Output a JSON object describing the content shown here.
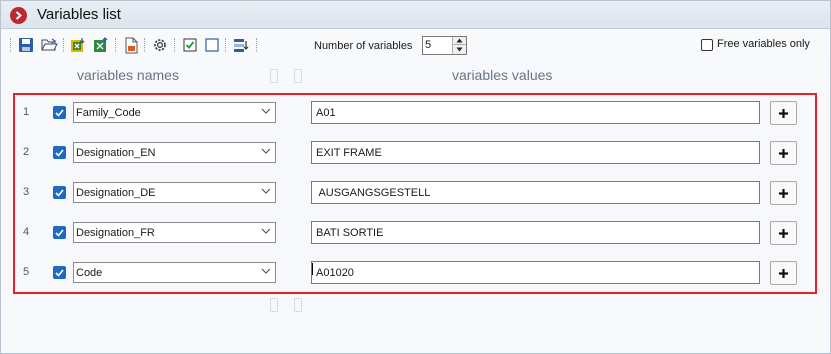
{
  "window": {
    "title": "Variables list"
  },
  "toolbar": {
    "number_label": "Number of variables",
    "number_value": "5",
    "free_only_label": "Free variables only",
    "free_only_checked": false
  },
  "columns": {
    "names": "variables names",
    "values": "variables values"
  },
  "rows": [
    {
      "index": "1",
      "checked": true,
      "name": "Family_Code",
      "value": "A01"
    },
    {
      "index": "2",
      "checked": true,
      "name": "Designation_EN",
      "value": "EXIT FRAME"
    },
    {
      "index": "3",
      "checked": true,
      "name": "Designation_DE",
      "value": " AUSGANGSGESTELL"
    },
    {
      "index": "4",
      "checked": true,
      "name": "Designation_FR",
      "value": "BATI SORTIE"
    },
    {
      "index": "5",
      "checked": true,
      "name": "Code",
      "value": "A01020"
    }
  ],
  "colors": {
    "highlight_border": "#e32229",
    "checkbox_blue": "#1f6bc4",
    "title_icon": "#c0282f"
  }
}
